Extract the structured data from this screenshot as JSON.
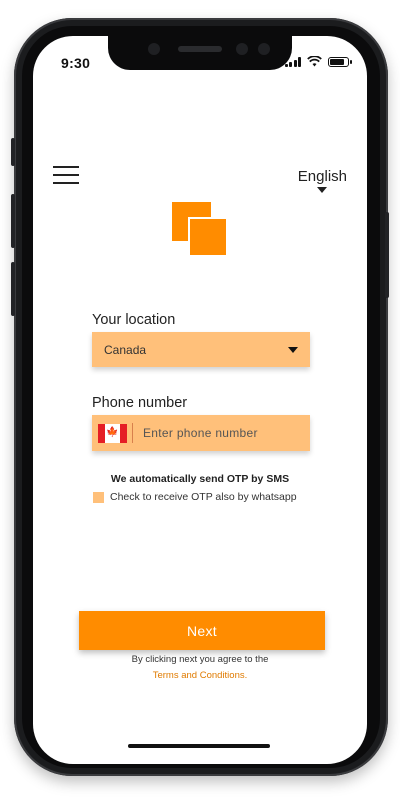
{
  "status_bar": {
    "time": "9:30"
  },
  "header": {
    "language": "English"
  },
  "location": {
    "label": "Your location",
    "value": "Canada"
  },
  "phone": {
    "label": "Phone number",
    "placeholder": "Enter phone number",
    "flag_symbol": "🍁"
  },
  "otp": {
    "notice": "We automatically send OTP by SMS",
    "whatsapp_label": "Check to receive OTP also by whatsapp"
  },
  "actions": {
    "next_label": "Next"
  },
  "terms": {
    "note": "By clicking next you agree to the",
    "link": "Terms and Conditions."
  },
  "colors": {
    "accent": "#ff8c00",
    "field_bg": "#ffc07a",
    "link": "#e07b00"
  },
  "icons": [
    "menu-icon",
    "chevron-down-icon",
    "canada-flag-icon",
    "signal-icon",
    "wifi-icon",
    "battery-icon"
  ]
}
